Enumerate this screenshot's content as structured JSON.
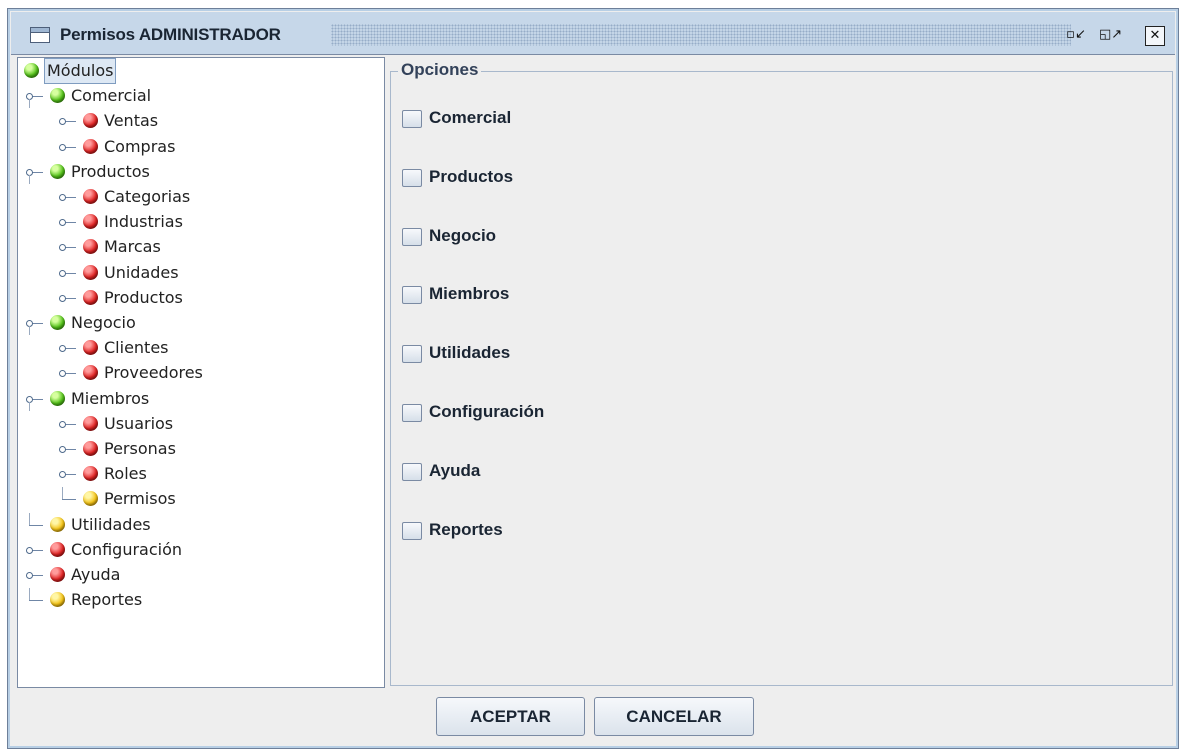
{
  "window": {
    "title": "Permisos ADMINISTRADOR",
    "buttons": [
      "minimize",
      "maximize",
      "close"
    ]
  },
  "tree": {
    "root": {
      "label": "Módulos",
      "status": "green"
    },
    "items": [
      {
        "label": "Comercial",
        "status": "green",
        "level": 1,
        "handle": "expanded"
      },
      {
        "label": "Ventas",
        "status": "red",
        "level": 2,
        "handle": "collapsed"
      },
      {
        "label": "Compras",
        "status": "red",
        "level": 2,
        "handle": "collapsed"
      },
      {
        "label": "Productos",
        "status": "green",
        "level": 1,
        "handle": "expanded"
      },
      {
        "label": "Categorias",
        "status": "red",
        "level": 2,
        "handle": "collapsed"
      },
      {
        "label": "Industrias",
        "status": "red",
        "level": 2,
        "handle": "collapsed"
      },
      {
        "label": "Marcas",
        "status": "red",
        "level": 2,
        "handle": "collapsed"
      },
      {
        "label": "Unidades",
        "status": "red",
        "level": 2,
        "handle": "collapsed"
      },
      {
        "label": "Productos",
        "status": "red",
        "level": 2,
        "handle": "collapsed"
      },
      {
        "label": "Negocio",
        "status": "green",
        "level": 1,
        "handle": "expanded"
      },
      {
        "label": "Clientes",
        "status": "red",
        "level": 2,
        "handle": "collapsed"
      },
      {
        "label": "Proveedores",
        "status": "red",
        "level": 2,
        "handle": "collapsed"
      },
      {
        "label": "Miembros",
        "status": "green",
        "level": 1,
        "handle": "expanded"
      },
      {
        "label": "Usuarios",
        "status": "red",
        "level": 2,
        "handle": "collapsed"
      },
      {
        "label": "Personas",
        "status": "red",
        "level": 2,
        "handle": "collapsed"
      },
      {
        "label": "Roles",
        "status": "red",
        "level": 2,
        "handle": "collapsed"
      },
      {
        "label": "Permisos",
        "status": "yellow",
        "level": 2,
        "handle": "leaf"
      },
      {
        "label": "Utilidades",
        "status": "yellow",
        "level": 1,
        "handle": "leaf"
      },
      {
        "label": "Configuración",
        "status": "red",
        "level": 1,
        "handle": "collapsed"
      },
      {
        "label": "Ayuda",
        "status": "red",
        "level": 1,
        "handle": "collapsed"
      },
      {
        "label": "Reportes",
        "status": "yellow",
        "level": 1,
        "handle": "leaf"
      }
    ]
  },
  "options": {
    "legend": "Opciones",
    "checkboxes": [
      {
        "label": "Comercial",
        "checked": false
      },
      {
        "label": "Productos",
        "checked": false
      },
      {
        "label": "Negocio",
        "checked": false
      },
      {
        "label": "Miembros",
        "checked": false
      },
      {
        "label": "Utilidades",
        "checked": false
      },
      {
        "label": "Configuración",
        "checked": false
      },
      {
        "label": "Ayuda",
        "checked": false
      },
      {
        "label": "Reportes",
        "checked": false
      }
    ]
  },
  "buttons": {
    "accept": "ACEPTAR",
    "cancel": "CANCELAR"
  },
  "colors": {
    "titlebar": "#c6d7e9",
    "status_green": "#54c21a",
    "status_red": "#e02424",
    "status_yellow": "#f4c316"
  }
}
